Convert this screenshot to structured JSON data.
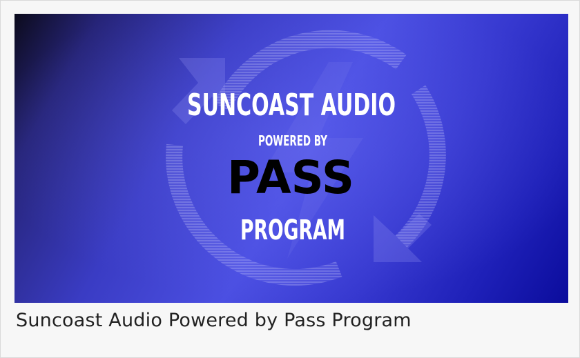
{
  "image": {
    "line1": "SUNCOAST AUDIO",
    "line2": "POWERED BY",
    "line3": "PASS",
    "line4": "PROGRAM"
  },
  "caption": "Suncoast Audio Powered by Pass Program",
  "colors": {
    "accent": "#3a3cc4",
    "text_on_image": "#ffffff",
    "pass_text": "#000000",
    "caption_text": "#222222"
  },
  "icons": [
    "refresh-cycle-icon"
  ]
}
